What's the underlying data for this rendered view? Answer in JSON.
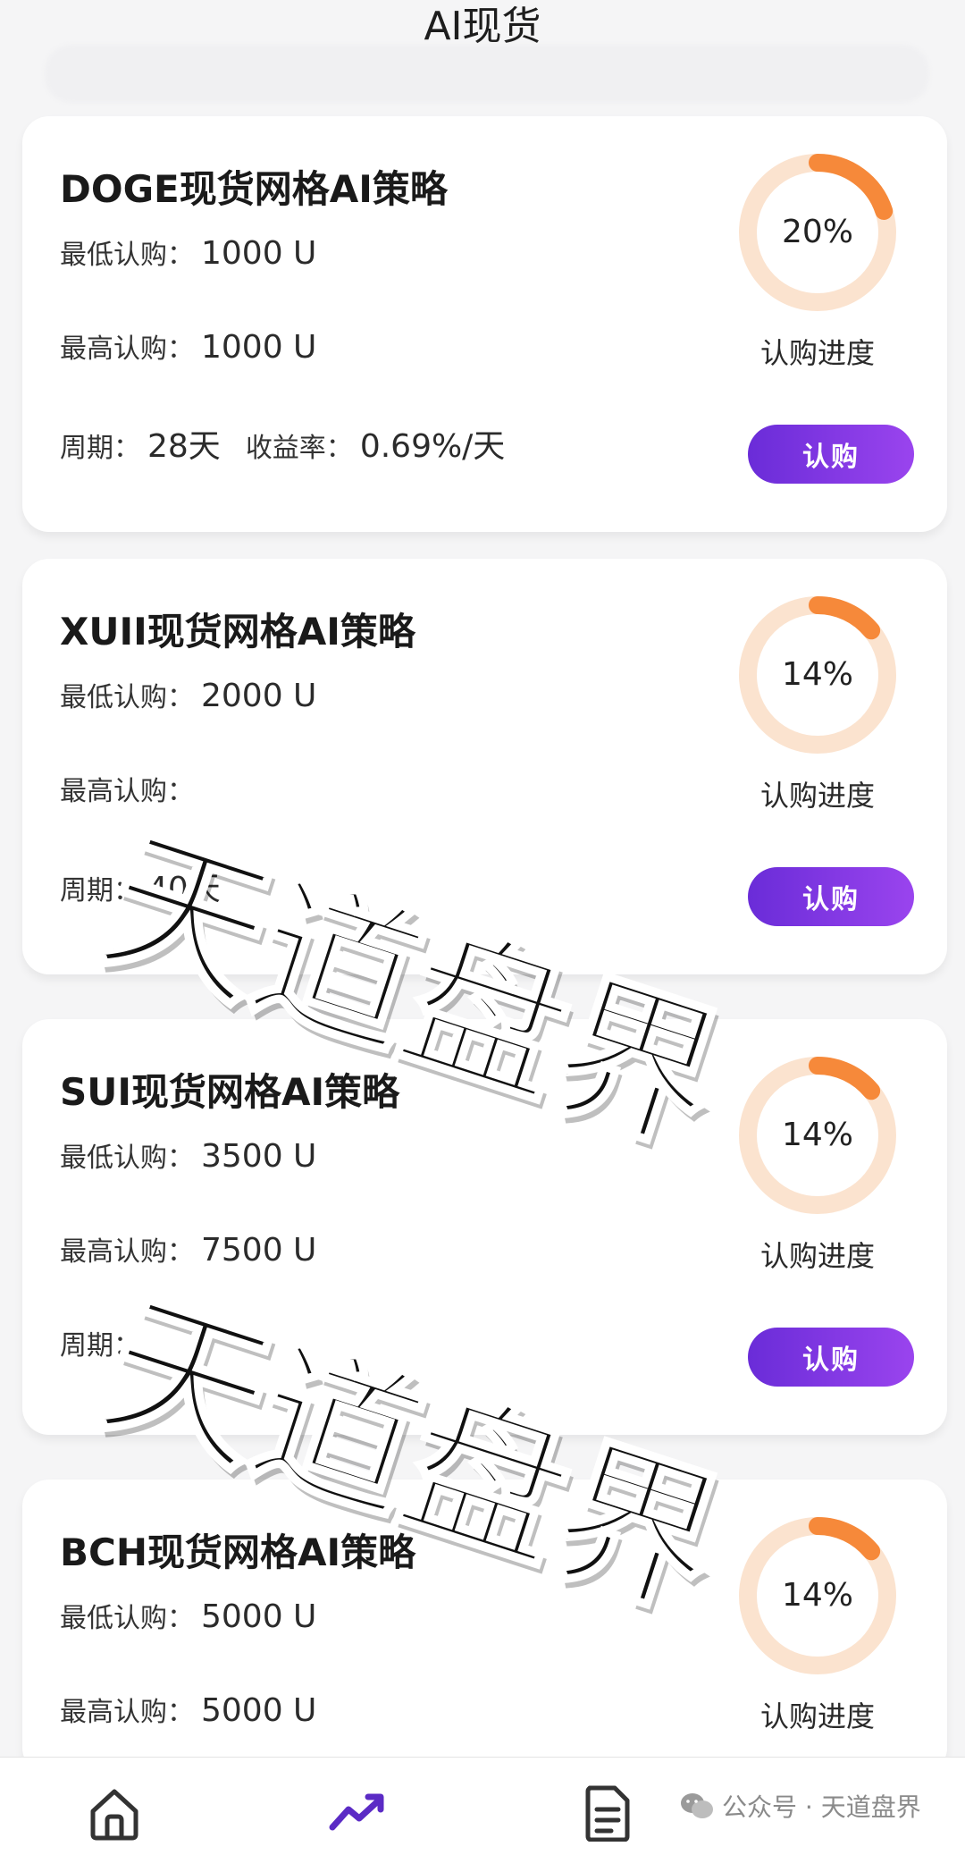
{
  "header": {
    "title": "AI现货"
  },
  "labels": {
    "min_subscribe": "最低认购：",
    "max_subscribe": "最高认购：",
    "period": "周期：",
    "yield": "收益率：",
    "progress": "认购进度",
    "buy": "认购"
  },
  "cards": [
    {
      "title": "DOGE现货网格AI策略",
      "min": "1000 U",
      "max": "1000 U",
      "period": "28天",
      "yield": "0.69%/天",
      "progress_text": "20%",
      "progress": 0.2
    },
    {
      "title": "XUII现货网格AI策略",
      "min": "2000 U",
      "max": "",
      "period": "40天",
      "yield": "",
      "progress_text": "14%",
      "progress": 0.14
    },
    {
      "title": "SUI现货网格AI策略",
      "min": "3500 U",
      "max": "7500 U",
      "period": "",
      "yield": "",
      "progress_text": "14%",
      "progress": 0.14
    },
    {
      "title": "BCH现货网格AI策略",
      "min": "5000 U",
      "max": "5000 U",
      "period": "",
      "yield": "",
      "progress_text": "14%",
      "progress": 0.14
    }
  ],
  "watermark": {
    "text": "天道盘界"
  },
  "footer": {
    "credit": "公众号 · 天道盘界"
  },
  "colors": {
    "ring_track": "#fbe3cf",
    "ring_fill": "#f6893a",
    "button_start": "#6a2cd8",
    "button_end": "#9a44ee",
    "nav_active": "#5b2bc5"
  },
  "nav": [
    {
      "icon": "home-icon",
      "active": false
    },
    {
      "icon": "trend-icon",
      "active": true
    },
    {
      "icon": "document-icon",
      "active": false
    }
  ]
}
